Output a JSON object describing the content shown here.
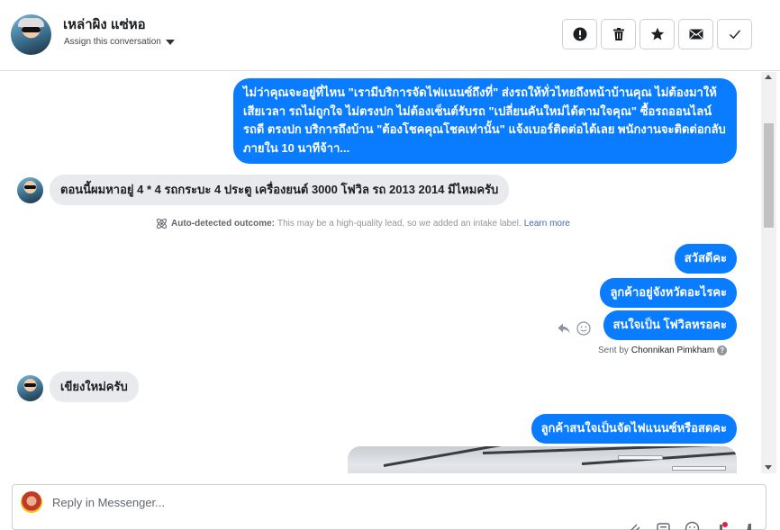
{
  "header": {
    "contact_name": "เหล่าผิง แซ่หอ",
    "assign_label": "Assign this conversation",
    "actions": [
      {
        "name": "mark-spam-button",
        "icon": "alert-circle-icon"
      },
      {
        "name": "delete-button",
        "icon": "trash-icon"
      },
      {
        "name": "star-button",
        "icon": "star-icon"
      },
      {
        "name": "mark-unread-button",
        "icon": "envelope-icon"
      },
      {
        "name": "mark-done-button",
        "icon": "checkmark-icon"
      }
    ]
  },
  "messages": {
    "m1": "ไม่ว่าคุณจะอยู่ที่ไหน \"เรามีบริการจัดไฟแนนซ์ถึงที่\"  ส่งรถให้ทั่วไทยถึงหน้าบ้านคุณ ไม่ต้องมาให้เสียเวลา รถไม่ถูกใจ ไม่ตรงปก ไม่ต้องเซ็นต์รับรถ \"เปลี่ยนคันใหม่ได้ตามใจคุณ\" ซื้อรถออนไลน์ รถดี ตรงปก บริการถึงบ้าน \"ต้องโชคคุณโชคเท่านั้น\" แจ้งเบอร์ติดต่อได้เลย พนักงานจะติดต่อกลับภายใน 10 นาทีจ้าา...",
    "m2": "ตอนนี้ผมหาอยู่ 4 * 4 รถกระบะ 4 ประตู เครื่องยนต์ 3000 โฟวิล รถ 2013 2014 มีไหมครับ",
    "m3": "สวัสดีคะ",
    "m4": "ลูกค้าอยู่จังหวัดอะไรคะ",
    "m5": "สนใจเป็น โฟวิลหรอคะ",
    "m6": "เขียงใหม่ครับ",
    "m7": "ลูกค้าสนใจเป็นจัดไฟแนนซ์หรือสดคะ"
  },
  "notice": {
    "title": "Auto-detected outcome:",
    "text": "This may be a high-quality lead, so we added an intake label.",
    "link": "Learn more"
  },
  "sent_by": {
    "prefix": "Sent by",
    "name": "Chonnikan Pimkham"
  },
  "composer": {
    "placeholder": "Reply in Messenger..."
  },
  "colors": {
    "outgoing_bubble": "#0a7cff",
    "incoming_bubble": "#e9eaed",
    "link": "#4267b2"
  }
}
